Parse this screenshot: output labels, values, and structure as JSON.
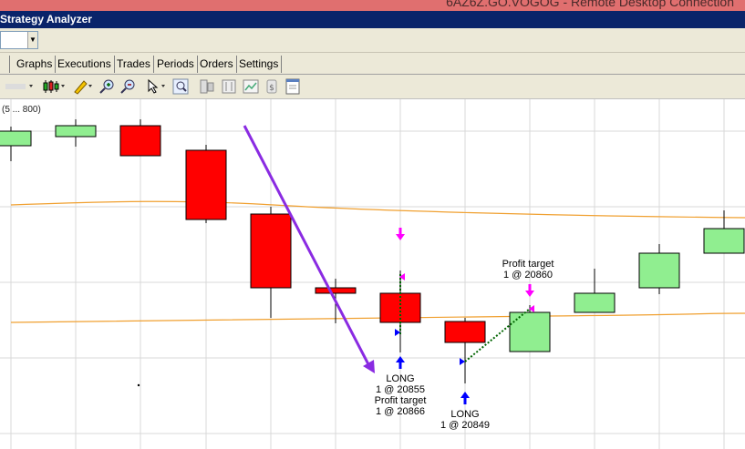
{
  "remote_window": {
    "title": "6AZ6Z.GO.VOGOG - Remote Desktop Connection"
  },
  "window": {
    "title": "Strategy Analyzer"
  },
  "tabs": [
    {
      "label": "Graphs"
    },
    {
      "label": "Executions"
    },
    {
      "label": "Trades"
    },
    {
      "label": "Periods"
    },
    {
      "label": "Orders"
    },
    {
      "label": "Settings"
    }
  ],
  "toolbar": {
    "icons": [
      "bar-type-icon",
      "candlestick-icon",
      "draw-pencil-icon",
      "zoom-in-icon",
      "zoom-out-icon",
      "pointer-icon",
      "zoom-region-icon",
      "data-box-icon",
      "panel-icon",
      "chart-properties-icon",
      "strategy-icon",
      "properties-icon"
    ]
  },
  "chart": {
    "caption": "(5 ... 800)",
    "colors": {
      "up": "#90ee90",
      "down": "#ff0000",
      "ma": "#f0a030",
      "arrow": "#8a2be2",
      "entry": "#0000ff",
      "exit": "#ff00ff",
      "trade_line": "#006400"
    }
  },
  "executions": [
    {
      "type": "LONG",
      "detail": "1 @ 20855"
    },
    {
      "type": "Profit target",
      "detail": "1 @ 20866"
    },
    {
      "type": "LONG",
      "detail": "1 @ 20849"
    },
    {
      "type": "Profit target",
      "detail": "1 @ 20860"
    }
  ]
}
